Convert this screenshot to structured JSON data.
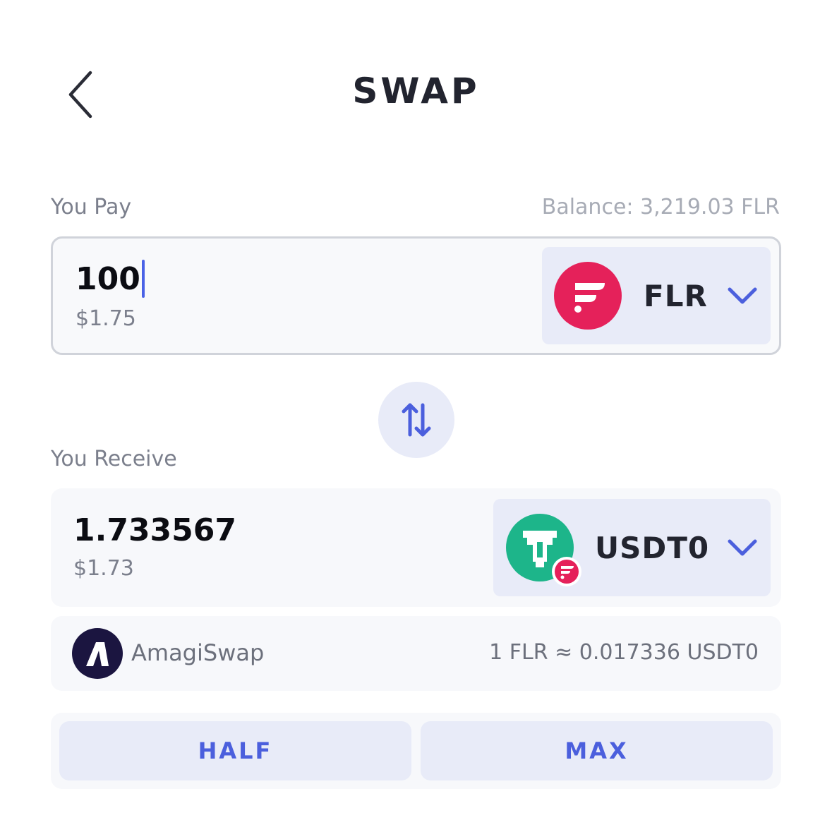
{
  "header": {
    "title": "SWAP",
    "back_icon": "chevron-left-icon"
  },
  "pay": {
    "label": "You Pay",
    "balance": "Balance: 3,219.03 FLR",
    "amount": "100",
    "fiat": "$1.75",
    "token": {
      "symbol": "FLR",
      "icon": "flare-logo-icon",
      "color": "#e5215a"
    }
  },
  "switch_icon": "swap-vertical-arrows-icon",
  "receive": {
    "label": "You Receive",
    "amount": "1.733567",
    "fiat": "$1.73",
    "token": {
      "symbol": "USDT0",
      "icon": "usdt0-logo-icon",
      "color": "#1db58a",
      "network_badge": "flare-network-badge-icon"
    }
  },
  "route": {
    "provider": "AmagiSwap",
    "provider_icon": "amagiswap-logo-icon",
    "rate": "1 FLR ≈ 0.017336 USDT0"
  },
  "actions": {
    "half_label": "HALF",
    "max_label": "MAX"
  },
  "colors": {
    "accent": "#4b5fdd",
    "chip_bg": "#e8ebf8"
  }
}
